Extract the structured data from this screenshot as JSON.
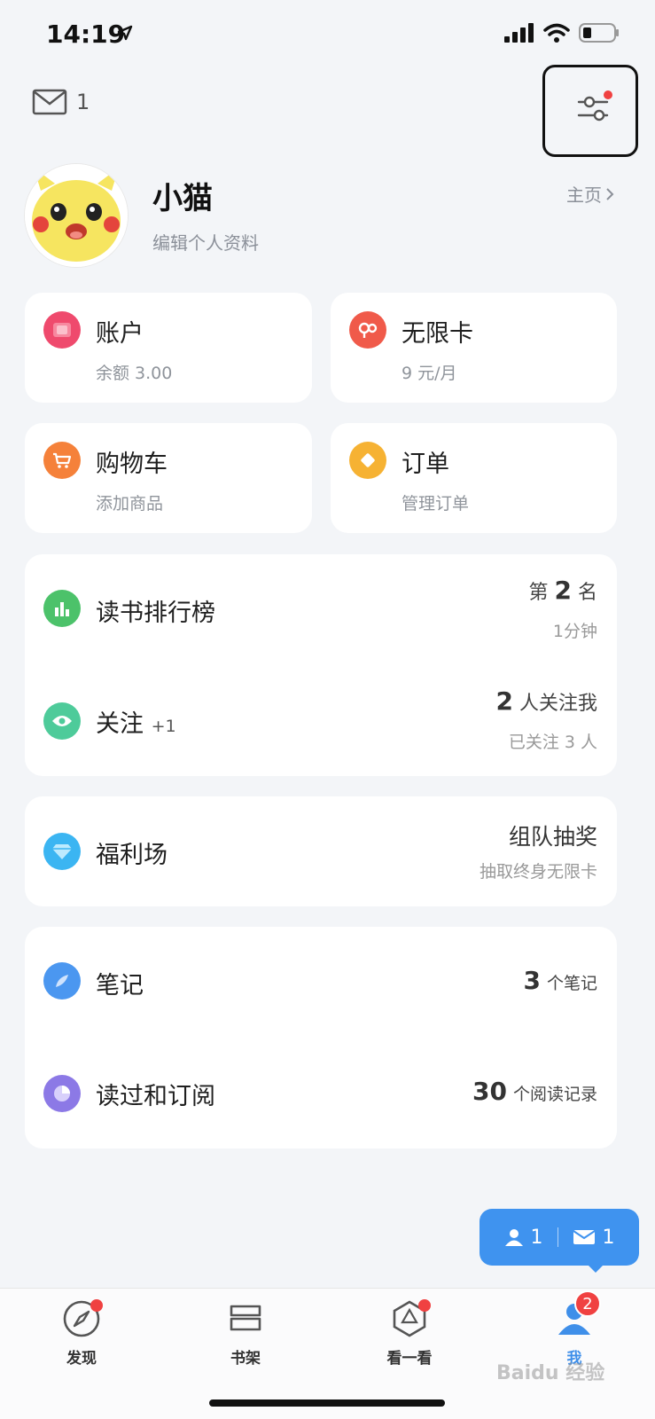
{
  "status": {
    "time": "14:19"
  },
  "header": {
    "mail_count": "1"
  },
  "profile": {
    "name": "小猫",
    "subtitle": "编辑个人资料",
    "home_link": "主页"
  },
  "cards": {
    "account": {
      "title": "账户",
      "sub": "余额 3.00"
    },
    "unlimited": {
      "title": "无限卡",
      "sub": "9 元/月"
    },
    "cart": {
      "title": "购物车",
      "sub": "添加商品"
    },
    "orders": {
      "title": "订单",
      "sub": "管理订单"
    }
  },
  "ranking": {
    "title": "读书排行榜",
    "rank_prefix": "第",
    "rank_value": "2",
    "rank_suffix": "名",
    "time": "1分钟"
  },
  "follow": {
    "title": "关注",
    "plus": "+1",
    "followers_num": "2",
    "followers_text": "人关注我",
    "following": "已关注 3 人"
  },
  "welfare": {
    "title": "福利场",
    "right_main": "组队抽奖",
    "right_sub": "抽取终身无限卡"
  },
  "notes": {
    "title": "笔记",
    "count": "3",
    "unit": "个笔记"
  },
  "history": {
    "title": "读过和订阅",
    "count": "30",
    "unit": "个阅读记录"
  },
  "float_pill": {
    "friends": "1",
    "messages": "1"
  },
  "tabs": [
    {
      "label": "发现",
      "icon": "compass-icon"
    },
    {
      "label": "书架",
      "icon": "bookshelf-icon"
    },
    {
      "label": "看一看",
      "icon": "look-icon"
    },
    {
      "label": "我",
      "icon": "me-icon",
      "badge": "2"
    }
  ],
  "watermark": "Baidu 经验",
  "colors": {
    "accent": "#3f93ef",
    "badge_red": "#f04141",
    "background": "#f3f5f8"
  }
}
